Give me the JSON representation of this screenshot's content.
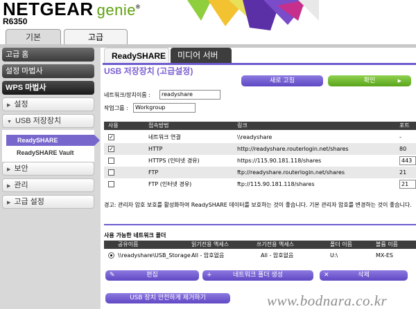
{
  "header": {
    "brand": "NETGEAR",
    "product": "genie",
    "registered": "®",
    "model": "R6350"
  },
  "top_tabs": {
    "basic": "기본",
    "advanced": "고급"
  },
  "sidebar": {
    "advanced_home": "고급 홈",
    "setup_wizard": "설정 마법사",
    "wps_wizard": "WPS 마법사",
    "setup": "설정",
    "usb_functions": "USB 저장장치",
    "sub_readyshare": "ReadySHARE",
    "sub_vault": "ReadySHARE Vault",
    "security": "보안",
    "administration": "관리",
    "advanced_setup": "고급 설정"
  },
  "content_tabs": {
    "readyshare": "ReadySHARE",
    "media_server": "미디어 서버"
  },
  "page_title": "USB 저장장치 (고급설정)",
  "buttons": {
    "refresh": "새로 고침",
    "apply": "확인",
    "apply_arrow": "▶",
    "edit": "편집",
    "create_folder": "네트워크 폴더 생성",
    "delete": "삭제",
    "safe_remove": "USB 장치 안전하게 제거하기"
  },
  "form": {
    "device_name_label": "네트워크/장치이름 :",
    "device_name_value": "readyshare",
    "workgroup_label": "작업그룹 :",
    "workgroup_value": "Workgroup"
  },
  "access_table": {
    "headers": {
      "use": "사용",
      "method": "접속방법",
      "link": "링크",
      "port": "포트"
    },
    "rows": [
      {
        "checked": true,
        "method": "네트워크 연결",
        "link": "\\\\readyshare",
        "port": "-"
      },
      {
        "checked": true,
        "method": "HTTP",
        "link": "http://readyshare.routerlogin.net/shares",
        "port": "80"
      },
      {
        "checked": false,
        "method": "HTTPS (인터넷 경유)",
        "link": "https://115.90.181.118/shares",
        "port": "443"
      },
      {
        "checked": false,
        "method": "FTP",
        "link": "ftp://readyshare.routerlogin.net/shares",
        "port": "21"
      },
      {
        "checked": false,
        "method": "FTP (인터넷 경유)",
        "link": "ftp://115.90.181.118/shares",
        "port": "21"
      }
    ]
  },
  "warning": "경고: 관리자 암호 보호를 활성화하여 ReadySHARE 데이터를 보호하는 것이 좋습니다. 기본 관리자 암호를 변경하는 것이 좋습니다.",
  "folders": {
    "title": "사용 가능한 네트워크 폴더",
    "headers": {
      "share_name": "공유이름",
      "read_access": "읽기전용 액세스",
      "write_access": "쓰기전용 액세스",
      "folder_name": "폴더 이름",
      "volume_name": "볼륨 이름"
    },
    "row": {
      "share_name": "\\\\readyshare\\USB_Storage",
      "read_access": "All - 암호없음",
      "write_access": "All - 암호없음",
      "folder_name": "U:\\",
      "volume_name": "MX-ES"
    }
  },
  "watermark": "www.bodnara.co.kr",
  "colors": {
    "accent_purple": "#6a5acd",
    "apply_green": "#5aa41b",
    "brand_green": "#5ea10e"
  }
}
